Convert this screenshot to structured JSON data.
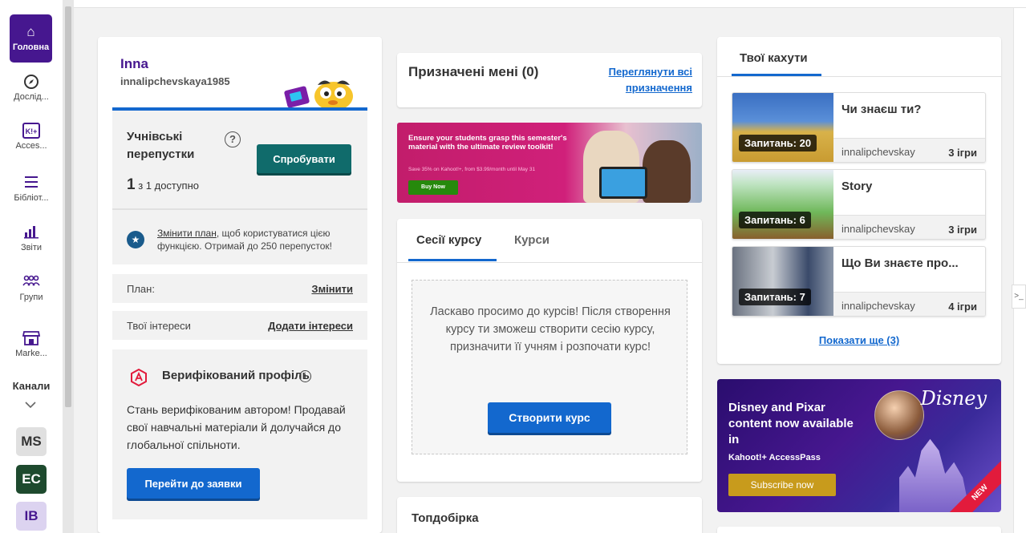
{
  "nav": {
    "items": [
      {
        "label": "Головна",
        "icon": "home-icon"
      },
      {
        "label": "Дослід...",
        "icon": "compass-icon"
      },
      {
        "label": "Acces...",
        "icon": "kahoot-plus-icon"
      },
      {
        "label": "Бібліот...",
        "icon": "list-icon"
      },
      {
        "label": "Звіти",
        "icon": "reports-icon"
      },
      {
        "label": "Групи",
        "icon": "groups-icon"
      },
      {
        "label": "Marke...",
        "icon": "store-icon"
      }
    ],
    "channels_label": "Канали",
    "channels": [
      {
        "label": "MS",
        "bg": "#e0e0e0",
        "fg": "#333333"
      },
      {
        "label": "EC",
        "bg": "#1e4a2e",
        "fg": "#ffffff"
      },
      {
        "label": "IB",
        "bg": "#dcd3f0",
        "fg": "#46178f"
      }
    ]
  },
  "profile": {
    "name": "Inna",
    "username": "innalipchevskaya1985",
    "passes_title": "Учнівські перепустки",
    "try_label": "Спробувати",
    "passes_count": "1",
    "passes_count_suffix": "з 1 доступно",
    "upgrade_link": "Змінити план",
    "upgrade_text": ", щоб користуватися цією функцією. Отримай до 250 перепусток!",
    "plan_label": "План:",
    "plan_action": "Змінити",
    "interests_label": "Твої інтереси",
    "interests_action": "Додати інтереси",
    "verified_title": "Верифікований профіль",
    "verified_text": "Стань верифікованим автором! Продавай свої навчальні матеріали й долучайся до глобальної спільноти.",
    "apply_label": "Перейти до заявки"
  },
  "assigned": {
    "title": "Призначені мені (0)",
    "link": "Переглянути всі призначення"
  },
  "promo": {
    "headline": "Ensure your students grasp this semester's material with the ultimate review toolkit!",
    "sub": "Save 35% on Kahoot!+, from $3.99/month until May 31",
    "button": "Buy Now"
  },
  "courses": {
    "tab_active": "Сесії курсу",
    "tab_other": "Курси",
    "message": "Ласкаво просимо до курсів! Після створення курсу ти зможеш створити сесію курсу, призначити її учням і розпочати курс!",
    "create_label": "Створити курс"
  },
  "top_selection": {
    "title": "Топдобірка"
  },
  "kahoots": {
    "tab": "Твої кахути",
    "items": [
      {
        "title": "Чи знаєш ти?",
        "asked": "Запитань: 20",
        "author": "innalipchevskay",
        "games": "3 ігри"
      },
      {
        "title": "Story",
        "asked": "Запитань: 6",
        "author": "innalipchevskay",
        "games": "3 ігри"
      },
      {
        "title": "Що Ви знаєте про...",
        "asked": "Запитань: 7",
        "author": "innalipchevskay",
        "games": "4 ігри"
      }
    ],
    "show_more": "Показати ще (3)"
  },
  "disney": {
    "headline": "Disney and Pixar content now available in",
    "brand": "Kahoot!+ AccessPass",
    "button": "Subscribe now",
    "logo": "Disney",
    "ribbon": "NEW"
  }
}
